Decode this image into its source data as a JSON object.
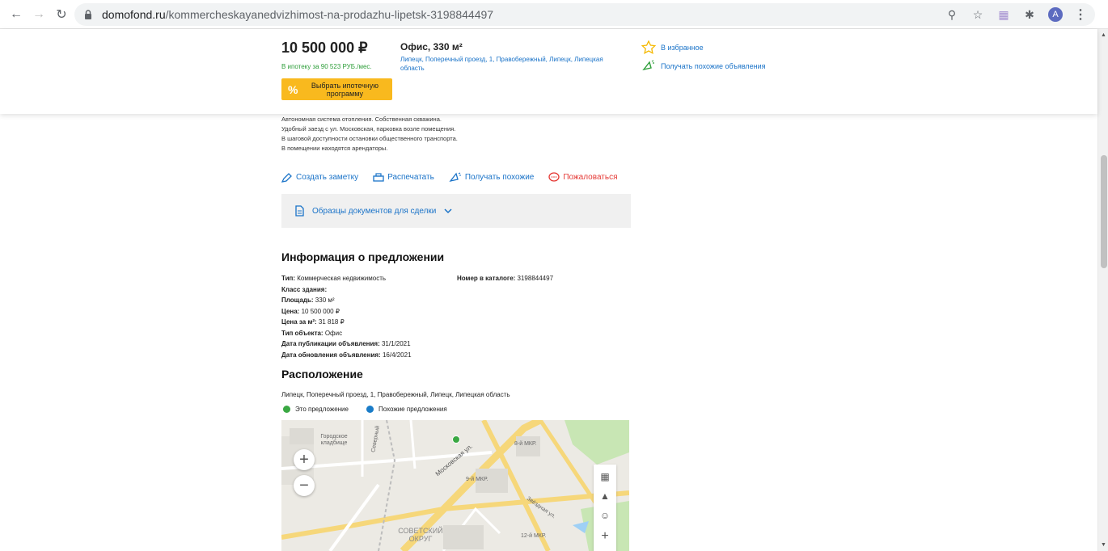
{
  "browser": {
    "url_host": "domofond.ru",
    "url_path": "/kommercheskayanedvizhimost-na-prodazhu-lipetsk-3198844497",
    "avatar_letter": "A"
  },
  "header": {
    "price": "10 500 000 ₽",
    "mortgage_text": "В ипотеку за 90 523 РУБ./мес.",
    "mortgage_btn_icon": "%",
    "mortgage_btn_label": "Выбрать ипотечную программу",
    "object_title": "Офис, 330 м²",
    "object_address": "Липецк, Поперечный проезд, 1, Правобережный, Липецк, Липецкая область",
    "favorites": "В избранное",
    "similar": "Получать похожие объявления"
  },
  "description": {
    "lines": [
      "Автономная система отопления. Собственная скважина.",
      "Удобный заезд с ул. Московская, парковка возле помещения.",
      "В шаговой доступности остановки общественного транспорта.",
      "В помещении находятся арендаторы."
    ]
  },
  "actions": {
    "note": "Создать заметку",
    "print": "Распечатать",
    "similar": "Получать похожие",
    "complain": "Пожаловаться"
  },
  "docs": {
    "label": "Образцы документов для сделки"
  },
  "info": {
    "title": "Информация о предложении",
    "rows": [
      {
        "key": "Тип:",
        "val": " Коммерческая недвижимость"
      },
      {
        "key": "Класс здания:",
        "val": ""
      },
      {
        "key": "Площадь:",
        "val": " 330 м²"
      },
      {
        "key": "Цена:",
        "val": " 10 500 000 ₽"
      },
      {
        "key": "Цена за м²:",
        "val": " 31 818 ₽"
      },
      {
        "key": "Тип объекта:",
        "val": " Офис"
      },
      {
        "key": "Дата публикации объявления:",
        "val": " 31/1/2021"
      },
      {
        "key": "Дата обновления объявления:",
        "val": " 16/4/2021"
      }
    ],
    "catalog_key": "Номер в каталоге:",
    "catalog_val": " 3198844497"
  },
  "location": {
    "title": "Расположение",
    "address": "Липецк, Поперечный проезд, 1, Правобережный, Липецк, Липецкая область",
    "legend_this": "Это предложение",
    "legend_similar": "Похожие предложения",
    "colors": {
      "this": "#3aa843",
      "similar": "#1a7cc8"
    },
    "map_labels": {
      "cemetery": "Городское кладбище",
      "district": "СОВЕТСКИЙ ОКРУГ",
      "moskovskaya": "Московская ул.",
      "mkr9": "9-й МКР.",
      "mkr8": "8-й МКР.",
      "mkr12": "12-й МКР.",
      "street_severny": "Северный",
      "street_zvezdnaya": "Звёздная ул."
    }
  }
}
